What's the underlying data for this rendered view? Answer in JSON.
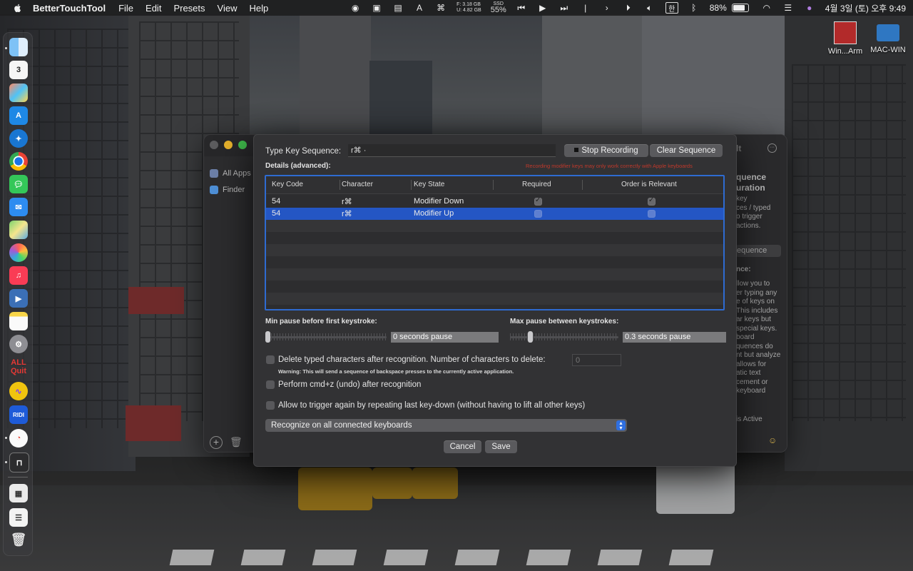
{
  "menubar": {
    "app_name": "BetterTouchTool",
    "menus": [
      "File",
      "Edit",
      "Presets",
      "View",
      "Help"
    ],
    "storage_f": "F: 3.18 GB",
    "storage_u": "U: 4.82 GB",
    "ssd_label": "SSD",
    "ssd_value": "55%",
    "battery": "88%",
    "ime": "한",
    "clock": "4월 3일 (토) 오후 9:49"
  },
  "desktop_icons": [
    {
      "label": "Win...Arm"
    },
    {
      "label": "MAC-WIN"
    }
  ],
  "dock": {
    "calendar_day": "3",
    "quit_label_1": "ALL",
    "quit_label_2": "Quit",
    "ridi_label": "RIDI"
  },
  "back_window": {
    "sidebar": [
      "All Apps",
      "Finder"
    ],
    "right_title": "lt",
    "right_lines_1": [
      "quence",
      "uration"
    ],
    "right_lines_2": [
      "key",
      "ces / typed",
      "o trigger",
      "actions."
    ],
    "right_button": "equence",
    "right_heading": "nce:",
    "right_lines_3": [
      "llow you to",
      "er typing any",
      "e of keys on",
      "This includes",
      "ar keys but",
      "special keys.",
      "board",
      "quences do",
      "nt but analyze",
      "allows for",
      "atic text",
      "cement or",
      "keyboard"
    ],
    "right_footer": "is Active"
  },
  "sheet": {
    "type_label": "Type Key Sequence:",
    "sequence_value": "r⌘ ·",
    "stop_recording": "Stop Recording",
    "clear_sequence": "Clear Sequence",
    "details_label": "Details (advanced):",
    "recording_warning": "Recording modifier keys may only work correctly with Apple keyboards",
    "table": {
      "headers": [
        "Key Code",
        "Character",
        "Key State",
        "Required",
        "Order is Relevant"
      ],
      "rows": [
        {
          "key_code": "54",
          "character": "r⌘",
          "key_state": "Modifier Down",
          "required": true,
          "order_relevant": true,
          "selected": false
        },
        {
          "key_code": "54",
          "character": "r⌘",
          "key_state": "Modifier Up",
          "required": false,
          "order_relevant": false,
          "selected": true
        }
      ]
    },
    "min_pause_label": "Min pause before first keystroke:",
    "min_pause_value": "0 seconds pause",
    "min_pause_level": 0.0,
    "max_pause_label": "Max pause between keystrokes:",
    "max_pause_value": "0.3 seconds pause",
    "max_pause_level": 0.17,
    "delete_label": "Delete typed characters after recognition. Number of characters to delete:",
    "delete_count_placeholder": "0",
    "delete_warning": "Warning: This will send a sequence of backspace presses to the currently active application.",
    "undo_label": "Perform cmd+z (undo) after recognition",
    "repeat_label": "Allow to trigger again by repeating last key-down (without having to lift all other keys)",
    "keyboard_select": "Recognize on all connected keyboards",
    "cancel": "Cancel",
    "save": "Save"
  }
}
